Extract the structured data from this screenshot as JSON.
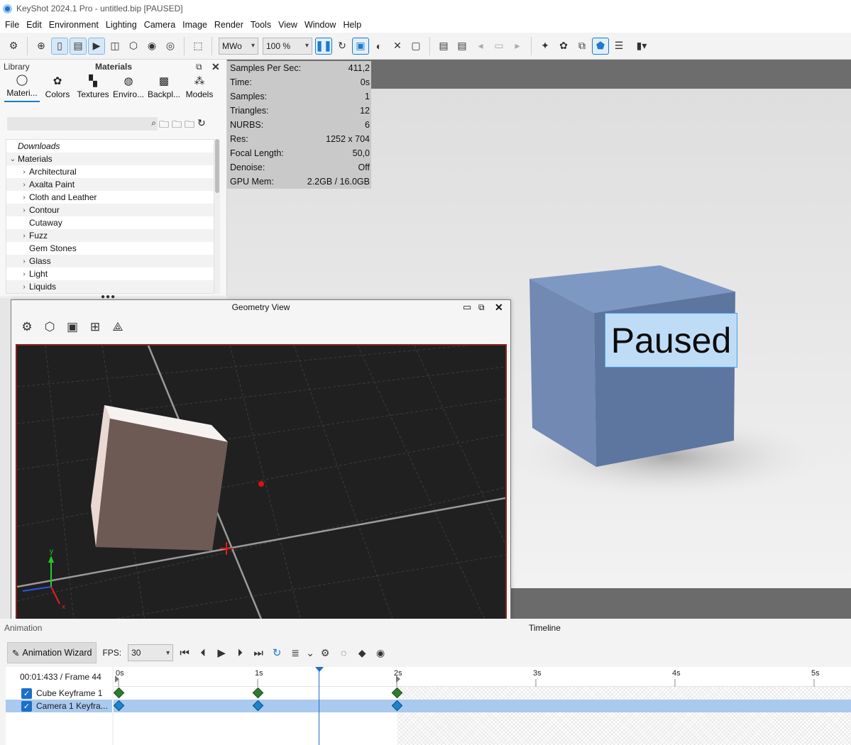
{
  "window": {
    "title": "KeyShot 2024.1 Pro  - untitled.bip  [PAUSED]"
  },
  "menu": [
    "File",
    "Edit",
    "Environment",
    "Lighting",
    "Camera",
    "Image",
    "Render",
    "Tools",
    "View",
    "Window",
    "Help"
  ],
  "toolbar": {
    "region_combo": "MWo",
    "zoom_combo": "100 %"
  },
  "library": {
    "header": "Library",
    "panel_title": "Materials",
    "tabs": [
      {
        "label": "Materi...",
        "icon": "material-ball-icon"
      },
      {
        "label": "Colors",
        "icon": "palette-icon"
      },
      {
        "label": "Textures",
        "icon": "checker-icon"
      },
      {
        "label": "Enviro...",
        "icon": "globe-icon"
      },
      {
        "label": "Backpl...",
        "icon": "image-icon"
      },
      {
        "label": "Models",
        "icon": "models-icon"
      }
    ],
    "tree": [
      {
        "label": "Downloads",
        "indent": 0,
        "chev": "",
        "italic": true
      },
      {
        "label": "Materials",
        "indent": 0,
        "chev": "v"
      },
      {
        "label": "Architectural",
        "indent": 1,
        "chev": ">"
      },
      {
        "label": "Axalta Paint",
        "indent": 1,
        "chev": ">"
      },
      {
        "label": "Cloth and Leather",
        "indent": 1,
        "chev": ">"
      },
      {
        "label": "Contour",
        "indent": 1,
        "chev": ">"
      },
      {
        "label": "Cutaway",
        "indent": 1,
        "chev": ""
      },
      {
        "label": "Fuzz",
        "indent": 1,
        "chev": ">"
      },
      {
        "label": "Gem Stones",
        "indent": 1,
        "chev": ""
      },
      {
        "label": "Glass",
        "indent": 1,
        "chev": ">"
      },
      {
        "label": "Light",
        "indent": 1,
        "chev": ">"
      },
      {
        "label": "Liquids",
        "indent": 1,
        "chev": ">"
      }
    ]
  },
  "stats": [
    {
      "k": "Samples Per Sec:",
      "v": "411,2"
    },
    {
      "k": "Time:",
      "v": "0s"
    },
    {
      "k": "Samples:",
      "v": "1"
    },
    {
      "k": "Triangles:",
      "v": "12"
    },
    {
      "k": "NURBS:",
      "v": "6"
    },
    {
      "k": "Res:",
      "v": "1252 x 704"
    },
    {
      "k": "Focal Length:",
      "v": "50,0"
    },
    {
      "k": "Denoise:",
      "v": "Off"
    },
    {
      "k": "GPU Mem:",
      "v": "2.2GB / 16.0GB"
    }
  ],
  "render": {
    "paused_label": "Paused",
    "cube_color": "#6a84ad"
  },
  "geometry_view": {
    "title": "Geometry View",
    "axis_y": "y",
    "axis_x": "x"
  },
  "animation": {
    "panel_label": "Animation",
    "timeline_label": "Timeline",
    "wizard_label": "Animation Wizard",
    "fps_label": "FPS:",
    "fps_value": "30",
    "time_readout": "00:01:433 / Frame 44",
    "ruler": [
      "0s",
      "1s",
      "2s",
      "3s",
      "4s",
      "5s"
    ],
    "tracks": [
      {
        "label": "Cube Keyframe 1",
        "checked": true,
        "color": "#2e7d2e",
        "selected": false
      },
      {
        "label": "Camera 1 Keyfra...",
        "checked": true,
        "color": "#1c85c8",
        "selected": true
      }
    ]
  }
}
